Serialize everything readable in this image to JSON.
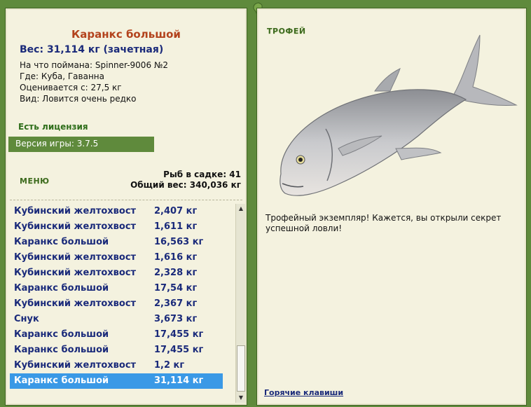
{
  "fish": {
    "title": "Каранкс большой",
    "weight": "Вес: 31,114 кг (зачетная)",
    "details": [
      "На что поймана: Spinner-9006 №2",
      "Где: Куба, Гаванна",
      "Оценивается с: 27,5 кг",
      "Вид: Ловится очень редко"
    ]
  },
  "license": "Есть лицензия",
  "version": "Версия игры: 3.7.5",
  "menu_label": "МЕНЮ",
  "stats": {
    "fish_count": "Рыб в садке: 41",
    "total_weight": "Общий вес: 340,036 кг"
  },
  "catch_list": [
    {
      "name": "Кубинский желтохвост",
      "weight": "2,407 кг"
    },
    {
      "name": "Кубинский желтохвост",
      "weight": "1,611 кг"
    },
    {
      "name": "Каранкс большой",
      "weight": "16,563 кг"
    },
    {
      "name": "Кубинский желтохвост",
      "weight": "1,616 кг"
    },
    {
      "name": "Кубинский желтохвост",
      "weight": "2,328 кг"
    },
    {
      "name": "Каранкс большой",
      "weight": "17,54 кг"
    },
    {
      "name": "Кубинский желтохвост",
      "weight": "2,367 кг"
    },
    {
      "name": "Снук",
      "weight": "3,673 кг"
    },
    {
      "name": "Каранкс большой",
      "weight": "17,455 кг"
    },
    {
      "name": "Каранкс большой",
      "weight": "17,455 кг"
    },
    {
      "name": "Кубинский желтохвост",
      "weight": "1,2 кг"
    },
    {
      "name": "Каранкс большой",
      "weight": "31,114 кг",
      "selected": true
    }
  ],
  "trophy": {
    "label": "ТРОФЕЙ",
    "message": "Трофейный экземпляр! Кажется, вы открыли секрет успешной ловли!"
  },
  "hotkeys_label": "Горячие клавиши",
  "icons": {
    "scroll_up": "triangle-up",
    "scroll_down": "triangle-down",
    "vine_decoration": "lizard-vine"
  },
  "colors": {
    "background": "#5f8a3c",
    "panel": "#f4f2df",
    "title": "#b3431d",
    "list_text": "#1a2a7a",
    "selection": "#3a99e6"
  }
}
